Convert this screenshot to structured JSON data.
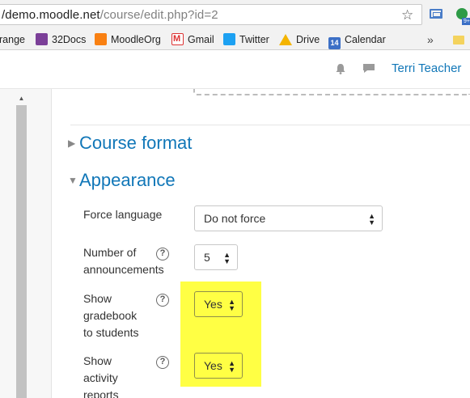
{
  "browser": {
    "url_host": "/demo.moodle.net",
    "url_path": "/course/edit.php?id=2",
    "bookmarks": [
      {
        "label": "range",
        "icon": "none"
      },
      {
        "label": "32Docs",
        "icon": "32docs-icon"
      },
      {
        "label": "MoodleOrg",
        "icon": "moodle-icon"
      },
      {
        "label": "Gmail",
        "icon": "gmail-icon"
      },
      {
        "label": "Twitter",
        "icon": "twitter-icon"
      },
      {
        "label": "Drive",
        "icon": "drive-icon"
      },
      {
        "label": "Calendar",
        "icon": "calendar-icon"
      }
    ],
    "calendar_day": "14",
    "more_label": "»",
    "extension_badge": "9+"
  },
  "navbar": {
    "user_name": "Terri Teacher"
  },
  "sections": {
    "course_format": "Course format",
    "appearance": "Appearance"
  },
  "form": {
    "force_language": {
      "label": "Force language",
      "value": "Do not force"
    },
    "announcements": {
      "label_line1": "Number of",
      "label_line2": "announcements",
      "value": "5"
    },
    "gradebook": {
      "label_line1": "Show",
      "label_line2": "gradebook",
      "label_line3": "to students",
      "value": "Yes"
    },
    "activity_reports": {
      "label_line1": "Show",
      "label_line2": "activity",
      "label_line3": "reports",
      "value": "Yes"
    }
  },
  "colors": {
    "link": "#1177b8",
    "highlight": "#ffff44"
  }
}
